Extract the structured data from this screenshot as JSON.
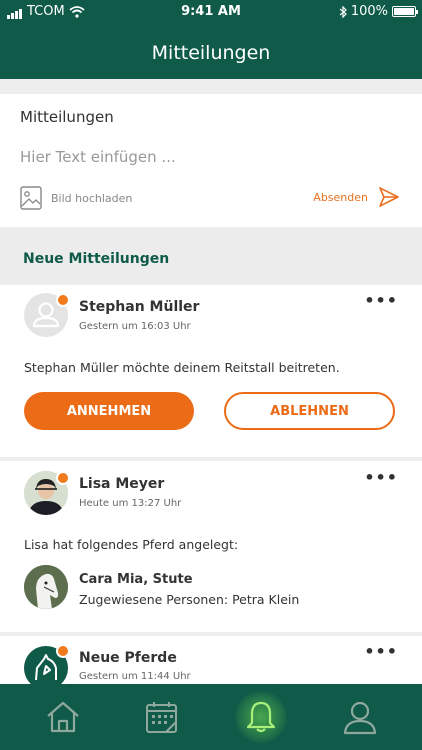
{
  "status_bar": {
    "carrier": "TCOM",
    "time": "9:41 AM",
    "battery": "100%"
  },
  "header": {
    "title": "Mitteilungen"
  },
  "composer": {
    "label": "Mitteilungen",
    "placeholder": "Hier Text einfügen ...",
    "upload_label": "Bild hochladen",
    "send_label": "Absenden"
  },
  "section": {
    "title": "Neue Mitteilungen"
  },
  "notifications": [
    {
      "name": "Stephan Müller",
      "time": "Gestern um 16:03 Uhr",
      "message": "Stephan Müller möchte deinem Reitstall beitreten.",
      "accept_label": "ANNEHMEN",
      "decline_label": "ABLEHNEN"
    },
    {
      "name": "Lisa Meyer",
      "time": "Heute um 13:27 Uhr",
      "message": "Lisa hat folgendes Pferd angelegt:",
      "horse": {
        "name": "Cara Mia, Stute",
        "assigned": "Zugewiesene Personen: Petra Klein"
      }
    },
    {
      "name": "Neue Pferde",
      "time": "Gestern um 11:44 Uhr"
    }
  ],
  "more_label": "•••",
  "tabbar": {
    "items": [
      "home-icon",
      "calendar-icon",
      "bell-icon",
      "profile-icon"
    ],
    "active": "bell-icon"
  },
  "colors": {
    "primary": "#0f5a48",
    "accent": "#ec6b16",
    "badge": "#f07a1c"
  }
}
